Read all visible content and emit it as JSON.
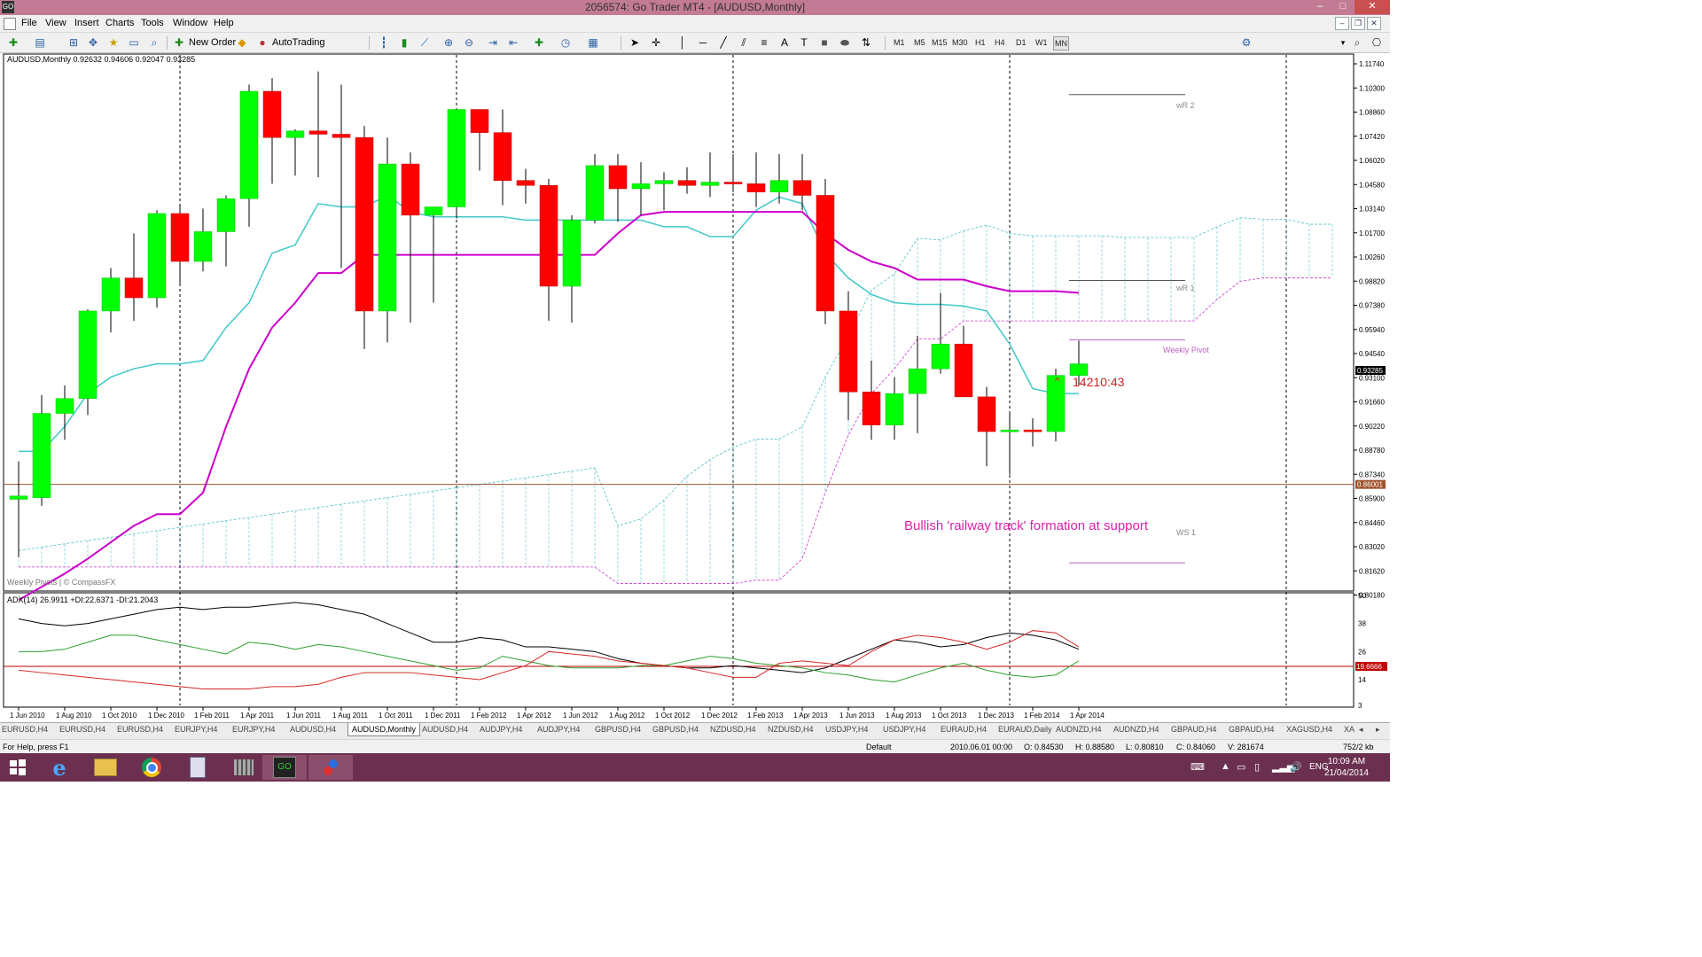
{
  "window": {
    "title": "2056574: Go Trader MT4 - [AUDUSD,Monthly]",
    "app_icon_text": "GO"
  },
  "menu": {
    "items": [
      "File",
      "View",
      "Insert",
      "Charts",
      "Tools",
      "Window",
      "Help"
    ]
  },
  "toolbar": {
    "new_order_label": "New Order",
    "autotrading_label": "AutoTrading",
    "timeframes": [
      "M1",
      "M5",
      "M15",
      "M30",
      "H1",
      "H4",
      "D1",
      "W1",
      "MN"
    ],
    "active_timeframe": "MN"
  },
  "chart": {
    "header": "AUDUSD,Monthly  0.92632 0.94606 0.92047 0.93285",
    "watermark": "Weekly Pivots | © CompassFX",
    "annotation": "Bullish 'railway track' formation at support",
    "countdown": "14210:43",
    "pivot_labels": {
      "wr2": "wR 2",
      "wr1": "wR 1",
      "pivot": "Weekly Pivot",
      "ws1": "WS 1"
    },
    "price_axis": [
      "1.11740",
      "1.10300",
      "1.08860",
      "1.07420",
      "1.06020",
      "1.04580",
      "1.03140",
      "1.01700",
      "1.00260",
      "0.98820",
      "0.97380",
      "0.95940",
      "0.94540",
      "0.93100",
      "0.91660",
      "0.90220",
      "0.88780",
      "0.87340",
      "0.85900",
      "0.84460",
      "0.83020",
      "0.81620",
      "0.80180"
    ],
    "current_price": "0.93285",
    "support_level": "0.86001",
    "indicator_header": "ADX(14) 26.9911 +DI:22.6371 -DI:21.2043",
    "indicator_axis": [
      "50",
      "38",
      "26",
      "14",
      "3"
    ],
    "indicator_level": "19.6666",
    "date_axis": [
      "1 Jun 2010",
      "1 Aug 2010",
      "1 Oct 2010",
      "1 Dec 2010",
      "1 Feb 2011",
      "1 Apr 2011",
      "1 Jun 2011",
      "1 Aug 2011",
      "1 Oct 2011",
      "1 Dec 2011",
      "1 Feb 2012",
      "1 Apr 2012",
      "1 Jun 2012",
      "1 Aug 2012",
      "1 Oct 2012",
      "1 Dec 2012",
      "1 Feb 2013",
      "1 Apr 2013",
      "1 Jun 2013",
      "1 Aug 2013",
      "1 Oct 2013",
      "1 Dec 2013",
      "1 Feb 2014",
      "1 Apr 2014"
    ],
    "colors": {
      "bull": "#00ff00",
      "bear": "#ff0000",
      "tenkan": "#40c8c8",
      "kijun": "#cc00cc",
      "support": "#a0522d",
      "adx": "#000000",
      "plus_di": "#2ca02c",
      "minus_di": "#d62728"
    }
  },
  "chart_data": {
    "type": "candlestick",
    "x": [
      "2010-06",
      "2010-07",
      "2010-08",
      "2010-09",
      "2010-10",
      "2010-11",
      "2010-12",
      "2011-01",
      "2011-02",
      "2011-03",
      "2011-04",
      "2011-05",
      "2011-06",
      "2011-07",
      "2011-08",
      "2011-09",
      "2011-10",
      "2011-11",
      "2011-12",
      "2012-01",
      "2012-02",
      "2012-03",
      "2012-04",
      "2012-05",
      "2012-06",
      "2012-07",
      "2012-08",
      "2012-09",
      "2012-10",
      "2012-11",
      "2012-12",
      "2013-01",
      "2013-02",
      "2013-03",
      "2013-04",
      "2013-05",
      "2013-06",
      "2013-07",
      "2013-08",
      "2013-09",
      "2013-10",
      "2013-11",
      "2013-12",
      "2014-01",
      "2014-02",
      "2014-03",
      "2014-04"
    ],
    "open": [
      0.851,
      0.852,
      0.903,
      0.912,
      0.965,
      0.985,
      0.973,
      1.024,
      0.995,
      1.013,
      1.033,
      1.098,
      1.07,
      1.074,
      1.072,
      1.07,
      0.965,
      1.054,
      1.023,
      1.028,
      1.087,
      1.073,
      1.044,
      1.041,
      0.98,
      1.02,
      1.053,
      1.039,
      1.042,
      1.044,
      1.041,
      1.043,
      1.042,
      1.037,
      1.044,
      1.035,
      0.965,
      0.916,
      0.896,
      0.915,
      0.93,
      0.945,
      0.913,
      0.892,
      0.893,
      0.892,
      0.926
    ],
    "high": [
      0.874,
      0.914,
      0.92,
      0.966,
      0.991,
      1.012,
      1.026,
      1.029,
      1.027,
      1.035,
      1.102,
      1.106,
      1.075,
      1.11,
      1.102,
      1.077,
      1.07,
      1.061,
      1.025,
      1.06,
      1.086,
      1.087,
      1.051,
      1.045,
      1.023,
      1.06,
      1.06,
      1.055,
      1.049,
      1.052,
      1.061,
      1.06,
      1.061,
      1.06,
      1.06,
      1.045,
      0.977,
      0.935,
      0.925,
      0.95,
      0.976,
      0.956,
      0.919,
      0.903,
      0.9,
      0.93,
      0.947
    ],
    "high_low_note": "",
    "close": [
      0.853,
      0.903,
      0.912,
      0.965,
      0.985,
      0.973,
      1.024,
      0.995,
      1.013,
      1.033,
      1.098,
      1.07,
      1.074,
      1.072,
      1.07,
      0.965,
      1.054,
      1.023,
      1.028,
      1.087,
      1.073,
      1.044,
      1.041,
      0.98,
      1.02,
      1.053,
      1.039,
      1.042,
      1.044,
      1.041,
      1.043,
      1.042,
      1.037,
      1.044,
      1.035,
      0.965,
      0.916,
      0.896,
      0.915,
      0.93,
      0.945,
      0.913,
      0.892,
      0.893,
      0.892,
      0.926,
      0.933
    ],
    "low": [
      0.816,
      0.847,
      0.887,
      0.902,
      0.952,
      0.959,
      0.967,
      0.98,
      0.989,
      0.992,
      1.016,
      1.042,
      1.047,
      1.046,
      0.991,
      0.942,
      0.946,
      0.958,
      0.97,
      1.021,
      1.05,
      1.029,
      1.03,
      0.959,
      0.958,
      1.018,
      1.019,
      1.023,
      1.026,
      1.036,
      1.034,
      1.037,
      1.028,
      1.03,
      1.026,
      0.957,
      0.899,
      0.887,
      0.887,
      0.891,
      0.927,
      0.925,
      0.871,
      0.866,
      0.883,
      0.886,
      0.92
    ],
    "tenkan_sen": [
      0.88,
      0.88,
      0.895,
      0.915,
      0.925,
      0.93,
      0.933,
      0.933,
      0.935,
      0.955,
      0.97,
      1.0,
      1.005,
      1.03,
      1.028,
      1.028,
      1.035,
      1.025,
      1.022,
      1.022,
      1.022,
      1.022,
      1.02,
      1.02,
      1.02,
      1.02,
      1.02,
      1.02,
      1.016,
      1.016,
      1.01,
      1.01,
      1.026,
      1.034,
      1.03,
      1.0,
      0.985,
      0.975,
      0.97,
      0.969,
      0.969,
      0.968,
      0.965,
      0.945,
      0.918,
      0.915,
      0.915
    ],
    "kijun_sen": [
      0.79,
      0.798,
      0.806,
      0.815,
      0.825,
      0.835,
      0.842,
      0.842,
      0.855,
      0.895,
      0.93,
      0.955,
      0.97,
      0.988,
      0.988,
      0.999,
      0.999,
      0.999,
      0.999,
      0.999,
      0.999,
      0.999,
      0.999,
      0.999,
      0.999,
      0.999,
      1.012,
      1.023,
      1.025,
      1.025,
      1.025,
      1.025,
      1.025,
      1.025,
      1.025,
      1.012,
      1.002,
      0.995,
      0.991,
      0.984,
      0.984,
      0.984,
      0.98,
      0.977,
      0.977,
      0.977,
      0.976
    ],
    "support_level": 0.86001,
    "price_range": [
      0.796,
      1.12
    ],
    "adx": [
      40,
      38,
      37,
      38,
      40,
      42,
      44,
      45,
      44,
      45,
      45,
      46,
      47,
      46,
      44,
      42,
      38,
      34,
      30,
      30,
      32,
      31,
      28,
      28,
      27,
      26,
      23,
      21,
      20,
      19,
      19,
      20,
      19,
      18,
      17,
      19,
      23,
      27,
      31,
      30,
      28,
      29,
      32,
      34,
      33,
      31,
      27
    ],
    "plus_di": [
      26,
      26,
      27,
      30,
      33,
      33,
      31,
      29,
      27,
      25,
      30,
      29,
      27,
      29,
      28,
      26,
      24,
      22,
      20,
      18,
      19,
      24,
      22,
      20,
      19,
      19,
      19,
      20,
      20,
      22,
      24,
      23,
      21,
      20,
      19,
      17,
      16,
      14,
      13,
      16,
      19,
      21,
      18,
      16,
      15,
      16,
      22
    ],
    "minus_di": [
      18,
      17,
      16,
      15,
      14,
      13,
      12,
      11,
      10,
      10,
      10,
      11,
      11,
      12,
      15,
      17,
      17,
      17,
      16,
      15,
      14,
      17,
      20,
      26,
      25,
      24,
      22,
      21,
      20,
      19,
      17,
      15,
      15,
      21,
      22,
      21,
      20,
      26,
      31,
      33,
      32,
      30,
      27,
      30,
      35,
      34,
      28
    ],
    "adx_level": 19.6666,
    "adx_range": [
      3,
      50
    ]
  },
  "tabs": [
    "EURUSD,H4",
    "EURUSD,H4",
    "EURUSD,H4",
    "EURJPY,H4",
    "EURJPY,H4",
    "AUDUSD,H4",
    "AUDUSD,Monthly",
    "AUDUSD,H4",
    "AUDJPY,H4",
    "AUDJPY,H4",
    "GBPUSD,H4",
    "GBPUSD,H4",
    "NZDUSD,H4",
    "NZDUSD,H4",
    "USDJPY,H4",
    "USDJPY,H4",
    "EURAUD,H4",
    "EURAUD,Daily",
    "AUDNZD,H4",
    "AUDNZD,H4",
    "GBPAUD,H4",
    "GBPAUD,H4",
    "XAGUSD,H4",
    "XA"
  ],
  "active_tab": 6,
  "status": {
    "help": "For Help, press F1",
    "profile": "Default",
    "datetime": "2010.06.01 00:00",
    "open": "O: 0.84530",
    "high": "H: 0.88580",
    "low": "L: 0.80810",
    "close": "C: 0.84060",
    "volume": "V: 281674",
    "traffic": "752/2 kb"
  },
  "taskbar": {
    "lang": "ENG",
    "time": "10:09 AM",
    "date": "21/04/2014"
  }
}
